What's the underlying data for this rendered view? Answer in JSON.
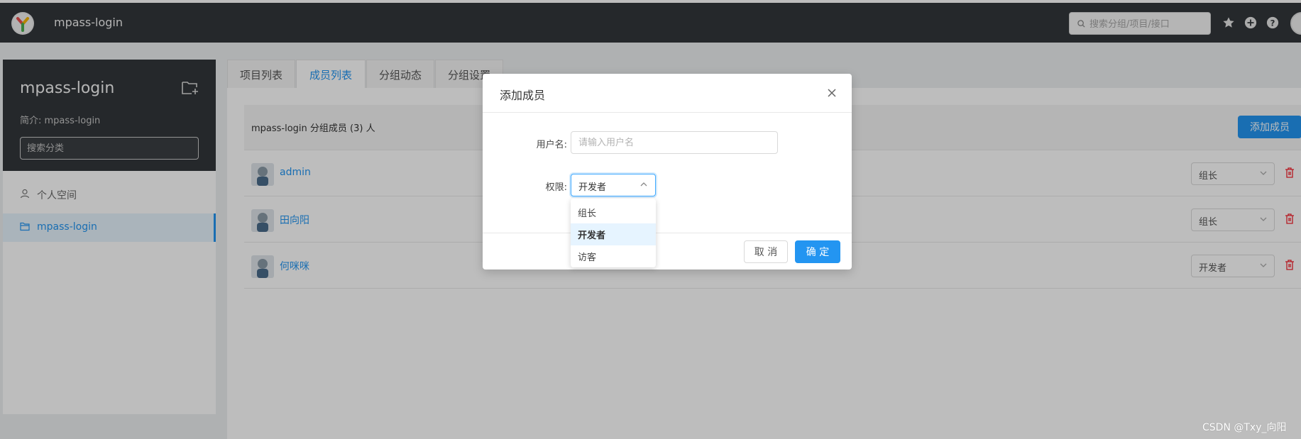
{
  "header": {
    "app_name": "mpass-login",
    "search_placeholder": "搜索分组/项目/接口"
  },
  "sidebar": {
    "group_title": "mpass-login",
    "group_desc": "简介: mpass-login",
    "search_placeholder": "搜索分类",
    "items": [
      {
        "label": "个人空间"
      },
      {
        "label": "mpass-login"
      }
    ]
  },
  "tabs": [
    {
      "label": "项目列表"
    },
    {
      "label": "成员列表"
    },
    {
      "label": "分组动态"
    },
    {
      "label": "分组设置"
    }
  ],
  "members": {
    "title": "mpass-login 分组成员 (3) 人",
    "add_button": "添加成员",
    "rows": [
      {
        "name": "admin",
        "role": "组长"
      },
      {
        "name": "田向阳",
        "role": "组长"
      },
      {
        "name": "何咪咪",
        "role": "开发者"
      }
    ]
  },
  "modal": {
    "title": "添加成员",
    "username_label": "用户名:",
    "username_placeholder": "请输入用户名",
    "permission_label": "权限:",
    "permission_value": "开发者",
    "cancel_label": "取 消",
    "ok_label": "确 定"
  },
  "dropdown": {
    "options": [
      {
        "label": "组长"
      },
      {
        "label": "开发者"
      },
      {
        "label": "访客"
      }
    ]
  },
  "watermark": "CSDN @Txy_向阳",
  "colors": {
    "accent": "#2395f1",
    "header_bg": "#32363a",
    "danger": "#f5222d"
  }
}
